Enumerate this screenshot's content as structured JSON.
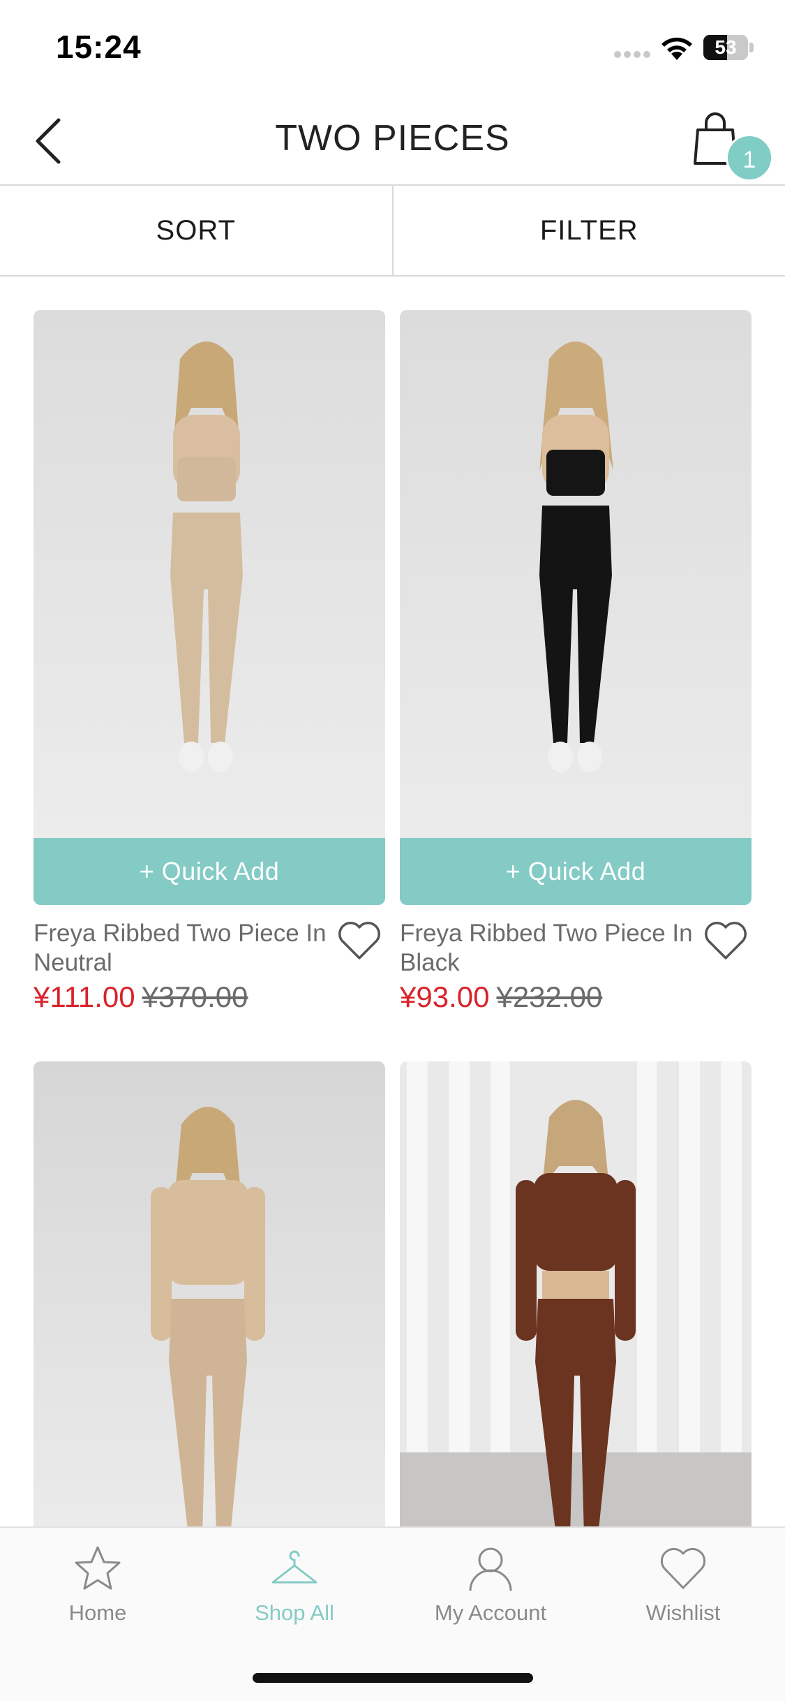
{
  "status_bar": {
    "time": "15:24",
    "battery": "53",
    "battery_level_percent": 53
  },
  "header": {
    "title": "TWO PIECES",
    "cart_count": "1",
    "icons": [
      "back-icon",
      "shopping-bag-icon"
    ]
  },
  "toolbar": {
    "sort_label": "SORT",
    "filter_label": "FILTER"
  },
  "products": [
    {
      "name": "Freya Ribbed Two Piece In Neutral",
      "sale_price": "¥111.00",
      "original_price": "¥370.00",
      "quick_add": "+ Quick Add"
    },
    {
      "name": "Freya Ribbed Two Piece In Black",
      "sale_price": "¥93.00",
      "original_price": "¥232.00",
      "quick_add": "+ Quick Add"
    }
  ],
  "tab_bar": {
    "active": "Shop All",
    "items": [
      {
        "label": "Home",
        "icon": "star-icon"
      },
      {
        "label": "Shop All",
        "icon": "hanger-icon"
      },
      {
        "label": "My Account",
        "icon": "user-icon"
      },
      {
        "label": "Wishlist",
        "icon": "heart-icon"
      }
    ]
  },
  "colors": {
    "accent": "#84cbc5",
    "sale": "#d8232a",
    "muted_text": "#6b6b6b"
  }
}
